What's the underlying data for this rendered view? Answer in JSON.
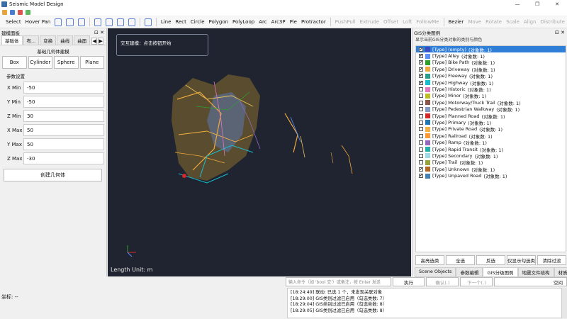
{
  "window": {
    "title": "Seismic Model Design",
    "controls": [
      "—",
      "❐",
      "✕"
    ]
  },
  "menu_icon_colors": [
    "#e8a33d",
    "#4a7bd0",
    "#d9534f",
    "#5cb85c"
  ],
  "toolbar": {
    "select": "Select",
    "hover_pan": "Hover Pan",
    "draw_tools": [
      "Line",
      "Rect",
      "Circle",
      "Polygon",
      "PolyLoop",
      "Arc",
      "Arc3P",
      "Pie",
      "Protractor"
    ],
    "disabled_tools": [
      "PushPull",
      "Extrude",
      "Offset",
      "Loft",
      "FollowMe"
    ],
    "bezier": "Bezier",
    "transform_tools": [
      "Move",
      "Rotate",
      "Scale",
      "Align",
      "Distribute"
    ]
  },
  "left_panel": {
    "title": "建模面板",
    "controls": "⊡ ✕",
    "tabs": [
      "基础体",
      "布...",
      "变换",
      "曲线",
      "曲面"
    ],
    "tab_arrows": [
      "◀",
      "▶"
    ],
    "group_title": "基础几何体建模",
    "shapes": [
      "Box",
      "Cylinder",
      "Sphere",
      "Plane"
    ],
    "params_title": "参数设置",
    "params": [
      {
        "label": "X Min",
        "value": "-50"
      },
      {
        "label": "Y Min",
        "value": "-50"
      },
      {
        "label": "Z Min",
        "value": "30"
      },
      {
        "label": "X Max",
        "value": "50"
      },
      {
        "label": "Y Max",
        "value": "50"
      },
      {
        "label": "Z Max",
        "value": "-30"
      }
    ],
    "create_button": "创建几何体"
  },
  "viewport": {
    "hint": "交互建模：点击按钮开始",
    "length_unit": "Length Unit: m"
  },
  "right_panel": {
    "title": "GIS分类图例",
    "controls": "⊡ ✕",
    "subtitle": "显示当前GIS分类对象的类别与颜色",
    "items": [
      {
        "label": "[Type] (empty)",
        "count": "(对象数: 1)",
        "color": "#3b4cc0",
        "checked": true,
        "selected": true
      },
      {
        "label": "[Type] Alley",
        "count": "(对象数: 1)",
        "color": "#5b8ff9",
        "checked": true,
        "selected": false
      },
      {
        "label": "[Type] Bike Path",
        "count": "(对象数: 1)",
        "color": "#2ca02c",
        "checked": true,
        "selected": false
      },
      {
        "label": "[Type] Driveway",
        "count": "(对象数: 1)",
        "color": "#f2a93b",
        "checked": true,
        "selected": false
      },
      {
        "label": "[Type] Freeway",
        "count": "(对象数: 1)",
        "color": "#2a9d8f",
        "checked": true,
        "selected": false
      },
      {
        "label": "[Type] Highway",
        "count": "(对象数: 1)",
        "color": "#17becf",
        "checked": true,
        "selected": false
      },
      {
        "label": "[Type] Historic",
        "count": "(对象数: 1)",
        "color": "#e377c2",
        "checked": false,
        "selected": false
      },
      {
        "label": "[Type] Minor",
        "count": "(对象数: 1)",
        "color": "#bcbd22",
        "checked": false,
        "selected": false
      },
      {
        "label": "[Type] Motorway/Truck Trail",
        "count": "(对象数: 1)",
        "color": "#8c564b",
        "checked": false,
        "selected": false
      },
      {
        "label": "[Type] Pedestrian Walkway",
        "count": "(对象数: 1)",
        "color": "#7f9cc9",
        "checked": false,
        "selected": false
      },
      {
        "label": "[Type] Planned Road",
        "count": "(对象数: 1)",
        "color": "#d62728",
        "checked": false,
        "selected": false
      },
      {
        "label": "[Type] Primary",
        "count": "(对象数: 1)",
        "color": "#1f77b4",
        "checked": false,
        "selected": false
      },
      {
        "label": "[Type] Private Road",
        "count": "(对象数: 1)",
        "color": "#f5b041",
        "checked": false,
        "selected": false
      },
      {
        "label": "[Type] Railroad",
        "count": "(对象数: 1)",
        "color": "#ff9933",
        "checked": false,
        "selected": false
      },
      {
        "label": "[Type] Ramp",
        "count": "(对象数: 1)",
        "color": "#9467bd",
        "checked": false,
        "selected": false
      },
      {
        "label": "[Type] Rapid Transit",
        "count": "(对象数: 1)",
        "color": "#20b2aa",
        "checked": false,
        "selected": false
      },
      {
        "label": "[Type] Secondary",
        "count": "(对象数: 1)",
        "color": "#9edae5",
        "checked": false,
        "selected": false
      },
      {
        "label": "[Type] Trail",
        "count": "(对象数: 1)",
        "color": "#98a23a",
        "checked": false,
        "selected": false
      },
      {
        "label": "[Type] Unknown",
        "count": "(对象数: 1)",
        "color": "#b5651d",
        "checked": true,
        "selected": false
      },
      {
        "label": "[Type] Unpaved Road",
        "count": "(对象数: 1)",
        "color": "#4682b4",
        "checked": true,
        "selected": false
      }
    ],
    "buttons": [
      "高亮选类",
      "全选",
      "反选",
      "仅显示勾选类",
      "清除过滤"
    ],
    "tabs": [
      "Scene Objects",
      "参数编辑",
      "GIS分级图例",
      "地震文件结构",
      "材质"
    ],
    "active_tab": 2
  },
  "command": {
    "placeholder": "输入命令（如 'bool 交'）或备注，按 Enter 发送",
    "execute": "执行",
    "confirm": "确认(.)",
    "next": "下一个(.)",
    "space": "空间"
  },
  "log": [
    "[18:24:49] 联动: 已选 1 个，未发现关联对象",
    "[18:29:00] GIS类别过滤已启用（勾选类数: 7）",
    "[18:29:04] GIS类别过滤已启用（勾选类数: 8）",
    "[18:29:05] GIS类别过滤已启用（勾选类数: 8）"
  ],
  "status": {
    "coord": "坐标: --"
  }
}
